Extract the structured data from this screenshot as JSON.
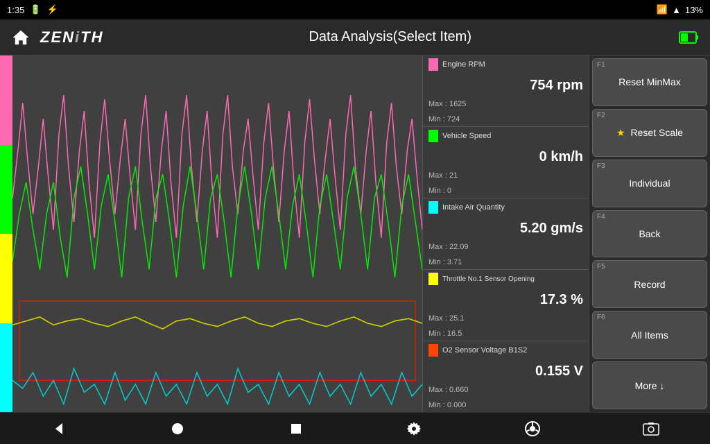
{
  "statusBar": {
    "time": "1:35",
    "battery": "13%"
  },
  "header": {
    "logo": "ZENiTH",
    "title": "Data Analysis(Select Item)"
  },
  "dataPanel": {
    "rows": [
      {
        "label": "Engine RPM",
        "color": "#ff69b4",
        "value": "754 rpm",
        "max": "Max : 1625",
        "min": "Min :  724"
      },
      {
        "label": "Vehicle Speed",
        "color": "#00ff00",
        "value": "0 km/h",
        "max": "Max :  21",
        "min": "Min :    0"
      },
      {
        "label": "Intake Air Quantity",
        "color": "#00ffff",
        "value": "5.20 gm/s",
        "max": "Max : 22.09",
        "min": "Min :  3.71"
      },
      {
        "label": "Throttle No.1 Sensor Opening",
        "color": "#ffff00",
        "value": "17.3 %",
        "max": "Max : 25.1",
        "min": "Min : 16.5"
      },
      {
        "label": "O2 Sensor Voltage B1S2",
        "color": "#ff4500",
        "value": "0.155 V",
        "max": "Max : 0.660",
        "min": "Min : 0.000"
      }
    ]
  },
  "buttons": [
    {
      "id": "F1",
      "label": "Reset MinMax",
      "icon": ""
    },
    {
      "id": "F2",
      "label": "Reset Scale",
      "icon": "★"
    },
    {
      "id": "F3",
      "label": "Individual",
      "icon": ""
    },
    {
      "id": "F4",
      "label": "Back",
      "icon": ""
    },
    {
      "id": "F5",
      "label": "Record",
      "icon": ""
    },
    {
      "id": "F6",
      "label": "All Items",
      "icon": ""
    },
    {
      "id": "",
      "label": "More ↓",
      "icon": ""
    }
  ],
  "navBar": {
    "back": "◄",
    "home": "●",
    "square": "■",
    "settings": "⚙",
    "chrome": "◉",
    "camera": "📷"
  }
}
